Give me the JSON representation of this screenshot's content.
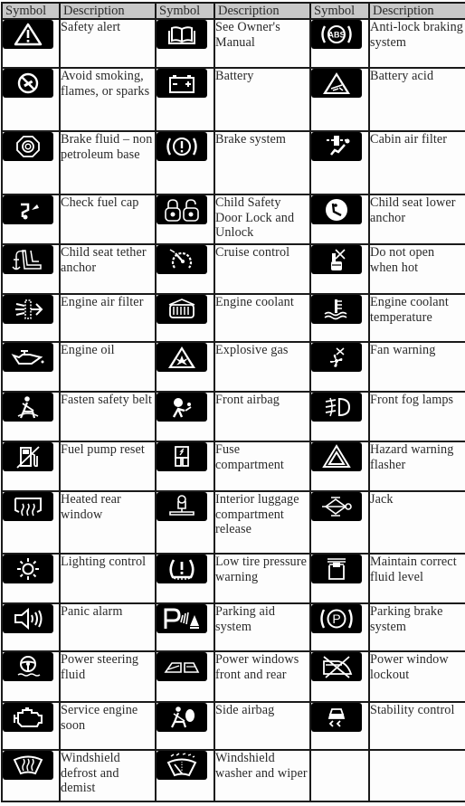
{
  "headers": [
    "Symbol",
    "Description",
    "Symbol",
    "Description",
    "Symbol",
    "Description"
  ],
  "rows": [
    [
      {
        "icon": "safety-alert-icon",
        "label": "Safety alert"
      },
      {
        "icon": "owners-manual-icon",
        "label": "See Owner's Manual"
      },
      {
        "icon": "abs-icon",
        "label": "Anti-lock braking system"
      }
    ],
    [
      {
        "icon": "no-smoking-icon",
        "label": "Avoid smoking, flames, or sparks"
      },
      {
        "icon": "battery-icon",
        "label": "Battery"
      },
      {
        "icon": "battery-acid-icon",
        "label": "Battery acid"
      }
    ],
    [
      {
        "icon": "brake-fluid-icon",
        "label": "Brake fluid – non petroleum base"
      },
      {
        "icon": "brake-system-icon",
        "label": "Brake system"
      },
      {
        "icon": "cabin-air-filter-icon",
        "label": "Cabin air filter"
      }
    ],
    [
      {
        "icon": "check-fuel-cap-icon",
        "label": "Check fuel cap"
      },
      {
        "icon": "child-safety-lock-icon",
        "label": "Child Safety Door Lock and Unlock"
      },
      {
        "icon": "child-seat-lower-anchor-icon",
        "label": "Child seat lower anchor"
      }
    ],
    [
      {
        "icon": "child-seat-tether-icon",
        "label": "Child seat tether anchor"
      },
      {
        "icon": "cruise-control-icon",
        "label": "Cruise control"
      },
      {
        "icon": "do-not-open-hot-icon",
        "label": "Do not open when hot"
      }
    ],
    [
      {
        "icon": "engine-air-filter-icon",
        "label": "Engine air filter"
      },
      {
        "icon": "engine-coolant-icon",
        "label": "Engine coolant"
      },
      {
        "icon": "coolant-temperature-icon",
        "label": "Engine coolant temperature"
      }
    ],
    [
      {
        "icon": "engine-oil-icon",
        "label": "Engine oil"
      },
      {
        "icon": "explosive-gas-icon",
        "label": "Explosive gas"
      },
      {
        "icon": "fan-warning-icon",
        "label": "Fan warning"
      }
    ],
    [
      {
        "icon": "seat-belt-icon",
        "label": "Fasten safety belt"
      },
      {
        "icon": "front-airbag-icon",
        "label": "Front airbag"
      },
      {
        "icon": "front-fog-lamps-icon",
        "label": "Front fog lamps"
      }
    ],
    [
      {
        "icon": "fuel-pump-reset-icon",
        "label": "Fuel pump reset"
      },
      {
        "icon": "fuse-icon",
        "label": "Fuse compartment"
      },
      {
        "icon": "hazard-icon",
        "label": "Hazard warning flasher"
      }
    ],
    [
      {
        "icon": "rear-defrost-icon",
        "label": "Heated rear window"
      },
      {
        "icon": "trunk-release-icon",
        "label": "Interior luggage compartment release"
      },
      {
        "icon": "jack-icon",
        "label": "Jack"
      }
    ],
    [
      {
        "icon": "lighting-control-icon",
        "label": "Lighting control"
      },
      {
        "icon": "tire-pressure-icon",
        "label": "Low tire pressure warning"
      },
      {
        "icon": "fluid-level-icon",
        "label": "Maintain correct fluid level"
      }
    ],
    [
      {
        "icon": "panic-alarm-icon",
        "label": "Panic alarm"
      },
      {
        "icon": "parking-aid-icon",
        "label": "Parking aid system"
      },
      {
        "icon": "parking-brake-icon",
        "label": "Parking brake system"
      }
    ],
    [
      {
        "icon": "power-steering-icon",
        "label": "Power steering fluid"
      },
      {
        "icon": "power-windows-icon",
        "label": "Power windows front and rear"
      },
      {
        "icon": "window-lockout-icon",
        "label": "Power window lockout"
      }
    ],
    [
      {
        "icon": "check-engine-icon",
        "label": "Service engine soon"
      },
      {
        "icon": "side-airbag-icon",
        "label": "Side airbag"
      },
      {
        "icon": "stability-control-icon",
        "label": "Stability control"
      }
    ],
    [
      {
        "icon": "windshield-defrost-icon",
        "label": "Windshield defrost and demist"
      },
      {
        "icon": "windshield-washer-icon",
        "label": "Windshield washer and wiper"
      },
      {
        "icon": "",
        "label": ""
      }
    ]
  ]
}
